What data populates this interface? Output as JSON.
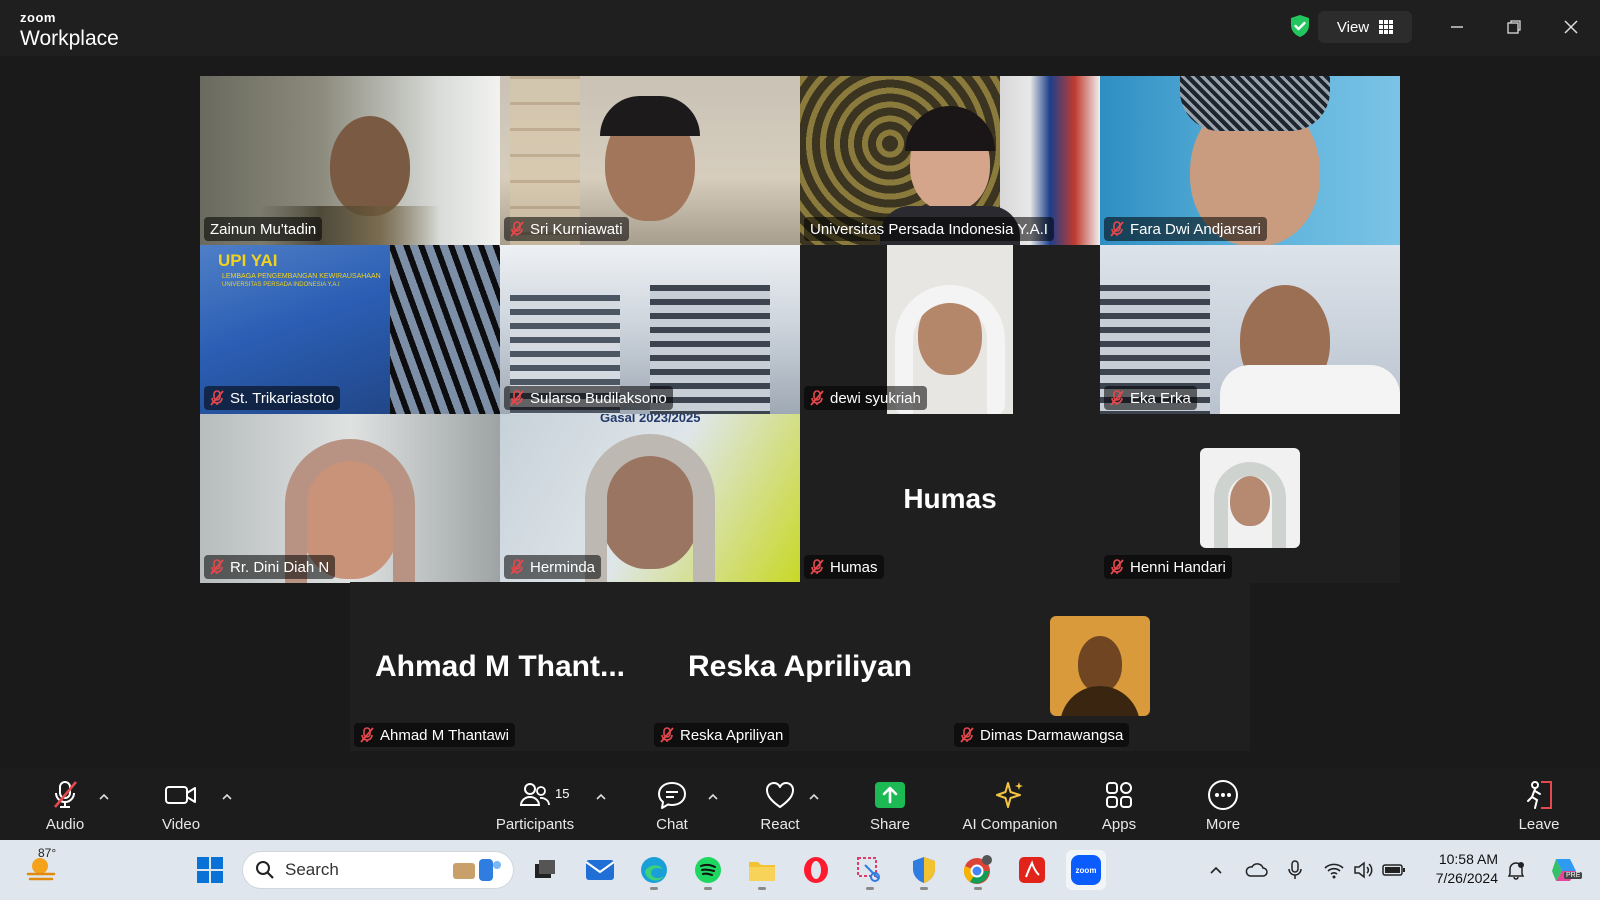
{
  "window": {
    "brand_top": "zoom",
    "brand_bottom": "Workplace",
    "view_label": "View"
  },
  "participants_grid": [
    {
      "name": "Zainun Mu'tadin",
      "muted": false
    },
    {
      "name": "Sri Kurniawati",
      "muted": true
    },
    {
      "name": "Universitas Persada Indonesia Y.A.I",
      "muted": false,
      "active_speaker": true
    },
    {
      "name": "Fara Dwi Andjarsari",
      "muted": true
    },
    {
      "name": "St. Trikariastoto",
      "muted": true
    },
    {
      "name": "Sularso Budilaksono",
      "muted": true
    },
    {
      "name": "dewi syukriah",
      "muted": true
    },
    {
      "name": "Eka Erka",
      "muted": true
    },
    {
      "name": "Rr. Dini Diah N",
      "muted": true
    },
    {
      "name": "Herminda",
      "muted": true
    },
    {
      "name": "Humas",
      "muted": true,
      "display_text": "Humas"
    },
    {
      "name": "Henni Handari",
      "muted": true
    }
  ],
  "bottom_row": [
    {
      "name": "Ahmad M Thantawi",
      "display_text": "Ahmad  M  Thant...",
      "muted": true
    },
    {
      "name": "Reska Apriliyan",
      "display_text": "Reska Apriliyan",
      "muted": true
    },
    {
      "name": "Dimas Darmawangsa",
      "muted": true
    }
  ],
  "background_texts": {
    "upi_logo": "UPI YAI",
    "upi_line1": "LEMBAGA PENGEMBANGAN KEWIRAUSAHAAN",
    "upi_line2": "UNIVERSITAS PERSADA INDONESIA Y.A.I",
    "partial_banner": "Gasal 2023/2025"
  },
  "toolbar": {
    "audio": "Audio",
    "video": "Video",
    "participants": "Participants",
    "participants_count": "15",
    "chat": "Chat",
    "react": "React",
    "share": "Share",
    "ai_companion": "AI Companion",
    "apps": "Apps",
    "more": "More",
    "leave": "Leave"
  },
  "taskbar": {
    "temperature": "87°",
    "search_placeholder": "Search",
    "time": "10:58 AM",
    "date": "7/26/2024",
    "copilot_badge": "PRE",
    "zoom_icon_text": "zoom"
  },
  "colors": {
    "active_speaker_border": "#2dd36f",
    "share_green": "#1db954",
    "muted_red": "#e5484d"
  }
}
